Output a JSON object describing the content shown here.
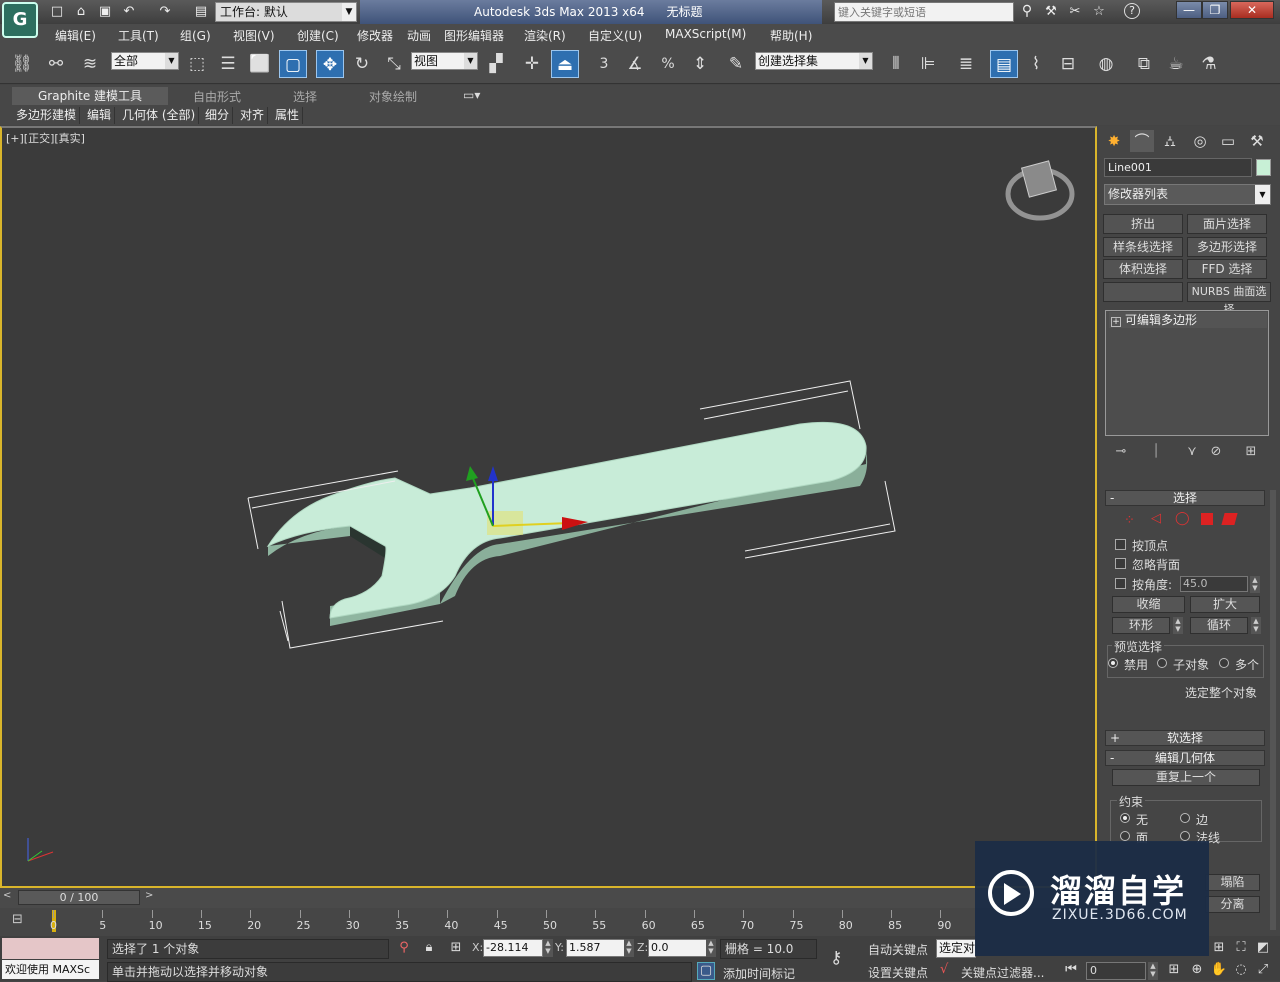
{
  "titlebar": {
    "workspace_label": "工作台: 默认",
    "app_name": "Autodesk 3ds Max  2013 x64",
    "doc_name": "无标题",
    "search_placeholder": "键入关键字或短语",
    "logo_glyph": "G"
  },
  "menu": [
    "编辑(E)",
    "工具(T)",
    "组(G)",
    "视图(V)",
    "创建(C)",
    "修改器",
    "动画",
    "图形编辑器",
    "渲染(R)",
    "自定义(U)",
    "MAXScript(M)",
    "帮助(H)"
  ],
  "toolbar": {
    "selection_filter": "全部",
    "ref_coord": "视图",
    "named_selection": "创建选择集",
    "snap_3": "3",
    "snap_angle_percent": "%"
  },
  "ribbon": {
    "tabs": [
      "Graphite 建模工具",
      "自由形式",
      "选择",
      "对象绘制"
    ],
    "subtabs": [
      "多边形建模",
      "编辑",
      "几何体 (全部)",
      "细分",
      "对齐",
      "属性"
    ]
  },
  "viewport": {
    "label": "[+][正交][真实]",
    "object_color": "#c8ecd8",
    "object_side_color": "#8fb5a0"
  },
  "command_panel": {
    "object_name": "Line001",
    "object_color": "#c8f0d6",
    "modifier_list": "修改器列表",
    "modifier_buttons": [
      "挤出",
      "面片选择",
      "样条线选择",
      "多边形选择",
      "体积选择",
      "FFD 选择",
      "",
      "NURBS 曲面选择"
    ],
    "stack_item": "可编辑多边形",
    "selection_rollout": {
      "title": "选择",
      "by_vertex": "按顶点",
      "ignore_backfacing": "忽略背面",
      "by_angle": "按角度:",
      "angle_value": "45.0",
      "shrink": "收缩",
      "grow": "扩大",
      "ring": "环形",
      "loop": "循环",
      "preview_label": "预览选择",
      "preview_off": "禁用",
      "preview_subobj": "子对象",
      "preview_multi": "多个",
      "select_whole": "选定整个对象"
    },
    "soft_selection": "软选择",
    "edit_geometry": {
      "title": "编辑几何体",
      "repeat_last": "重复上一个",
      "constraints_label": "约束",
      "none": "无",
      "edge": "边",
      "face": "面",
      "normal": "法线",
      "collapse": "塌陷",
      "detach": "分离"
    }
  },
  "timeline": {
    "frame_label": "0 / 100",
    "ticks": [
      "0",
      "5",
      "10",
      "15",
      "20",
      "25",
      "30",
      "35",
      "40",
      "45",
      "50",
      "55",
      "60",
      "65",
      "70",
      "75",
      "80",
      "85",
      "90"
    ]
  },
  "status": {
    "welcome": "欢迎使用 MAXSc",
    "selected": "选择了 1 个对象",
    "prompt": "单击并拖动以选择并移动对象",
    "x_value": "-28.114",
    "y_value": "1.587",
    "z_value": "0.0",
    "grid": "栅格 = 10.0",
    "auto_key": "自动关键点",
    "set_key": "设置关键点",
    "selected_combo": "选定对",
    "key_filters": "关键点过滤器...",
    "add_time_tag": "添加时间标记",
    "frame_value": "0"
  },
  "watermark": {
    "title": "溜溜自学",
    "url": "ZIXUE.3D66.COM"
  }
}
